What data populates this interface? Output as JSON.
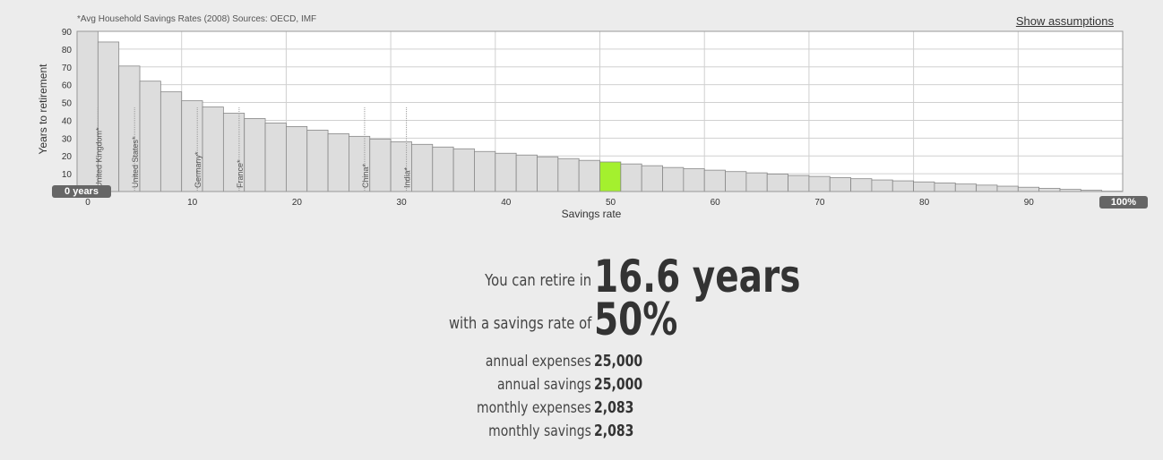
{
  "chart_data": {
    "type": "bar",
    "source_note": "*Avg Household Savings Rates (2008) Sources: OECD, IMF",
    "xlabel": "Savings rate",
    "ylabel": "Years to retirement",
    "xlim": [
      0,
      100
    ],
    "ylim": [
      0,
      90
    ],
    "x_ticks": [
      "0",
      "10",
      "20",
      "30",
      "40",
      "50",
      "60",
      "70",
      "80",
      "90"
    ],
    "y_ticks": [
      "10",
      "20",
      "30",
      "40",
      "50",
      "60",
      "70",
      "80",
      "90"
    ],
    "grid": true,
    "bar_width": 2,
    "highlight_x": 50,
    "highlight_color": "#a4f02e",
    "bar_color": "#dddddd",
    "x": [
      1,
      3,
      5,
      7,
      9,
      11,
      13,
      15,
      17,
      19,
      21,
      23,
      25,
      27,
      29,
      31,
      33,
      35,
      37,
      39,
      41,
      43,
      45,
      47,
      49,
      51,
      53,
      55,
      57,
      59,
      61,
      63,
      65,
      67,
      69,
      71,
      73,
      75,
      77,
      79,
      81,
      83,
      85,
      87,
      89,
      91,
      93,
      95,
      97,
      99
    ],
    "values": [
      90,
      84,
      70.5,
      62,
      56,
      51,
      47.5,
      44,
      41,
      38.5,
      36.5,
      34.5,
      32.5,
      31,
      29.5,
      28,
      26.5,
      25,
      24,
      22.5,
      21.5,
      20.5,
      19.5,
      18.5,
      17.5,
      16.6,
      15.5,
      14.5,
      13.5,
      12.8,
      12,
      11.2,
      10.5,
      9.8,
      9,
      8.5,
      7.8,
      7.2,
      6.5,
      6,
      5.4,
      4.8,
      4.2,
      3.6,
      3,
      2.4,
      1.8,
      1.2,
      0.7,
      0.2
    ],
    "country_markers": [
      {
        "name": "United Kingdom*",
        "x": 2
      },
      {
        "name": "United States*",
        "x": 5.5
      },
      {
        "name": "Germany*",
        "x": 11.5
      },
      {
        "name": "France*",
        "x": 15.5
      },
      {
        "name": "China*",
        "x": 27.5
      },
      {
        "name": "India*",
        "x": 31.5
      }
    ]
  },
  "controls": {
    "show_assumptions": "Show assumptions",
    "left_handle": "0 years",
    "right_handle": "100%"
  },
  "summary": {
    "retire_label": "You can retire in",
    "retire_value": "16.6 years",
    "rate_label": "with a savings rate of",
    "rate_value": "50%",
    "annual_expenses_label": "annual expenses",
    "annual_expenses_value": "25,000",
    "annual_savings_label": "annual savings",
    "annual_savings_value": "25,000",
    "monthly_expenses_label": "monthly expenses",
    "monthly_expenses_value": "2,083",
    "monthly_savings_label": "monthly savings",
    "monthly_savings_value": "2,083"
  }
}
